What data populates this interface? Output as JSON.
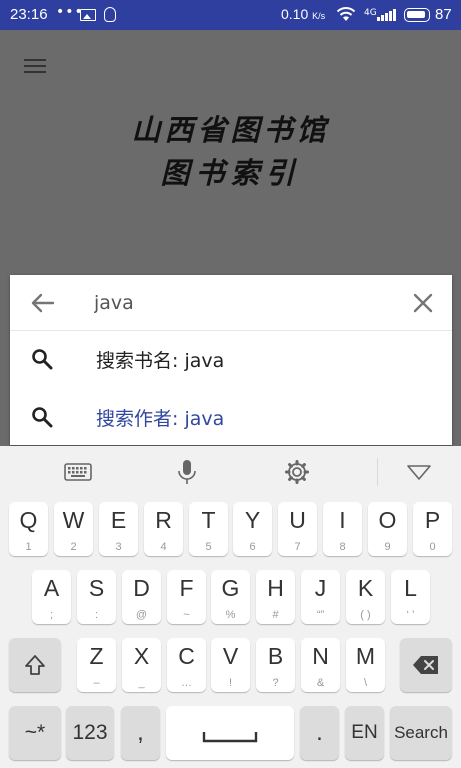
{
  "status_bar": {
    "time": "23:16",
    "dots": "•••",
    "net_speed": "0.10",
    "net_unit": "K/s",
    "signal_type": "4G",
    "battery": "87"
  },
  "app": {
    "title_line1": "山西省图书馆",
    "title_line2": "图书索引"
  },
  "search": {
    "value": "java",
    "suggestions": [
      {
        "label": "搜索书名:  java"
      },
      {
        "label": "搜索作者:  java"
      }
    ]
  },
  "colors": {
    "status_bar": "#2f3fa0",
    "accent_text": "#3147a0",
    "dim_overlay": "#6b6b6b"
  },
  "keyboard": {
    "toolbar_icons": [
      "keyboard-icon",
      "mic-icon",
      "gear-icon",
      "collapse-icon"
    ],
    "row1": [
      {
        "k": "Q",
        "s": "1"
      },
      {
        "k": "W",
        "s": "2"
      },
      {
        "k": "E",
        "s": "3"
      },
      {
        "k": "R",
        "s": "4"
      },
      {
        "k": "T",
        "s": "5"
      },
      {
        "k": "Y",
        "s": "6"
      },
      {
        "k": "U",
        "s": "7"
      },
      {
        "k": "I",
        "s": "8"
      },
      {
        "k": "O",
        "s": "9"
      },
      {
        "k": "P",
        "s": "0"
      }
    ],
    "row2": [
      {
        "k": "A",
        "s": ";"
      },
      {
        "k": "S",
        "s": ":"
      },
      {
        "k": "D",
        "s": "@"
      },
      {
        "k": "F",
        "s": "~"
      },
      {
        "k": "G",
        "s": "%"
      },
      {
        "k": "H",
        "s": "#"
      },
      {
        "k": "J",
        "s": "“”"
      },
      {
        "k": "K",
        "s": "( )"
      },
      {
        "k": "L",
        "s": "‘ ’"
      }
    ],
    "row3": [
      {
        "k": "Z",
        "s": "–"
      },
      {
        "k": "X",
        "s": "_"
      },
      {
        "k": "C",
        "s": "…"
      },
      {
        "k": "V",
        "s": "!"
      },
      {
        "k": "B",
        "s": "?"
      },
      {
        "k": "N",
        "s": "&"
      },
      {
        "k": "M",
        "s": "\\"
      }
    ],
    "symbols_label": "~*",
    "numbers_label": "123",
    "comma_label": ",",
    "period_label": ".",
    "lang_label": "EN",
    "search_label": "Search"
  }
}
